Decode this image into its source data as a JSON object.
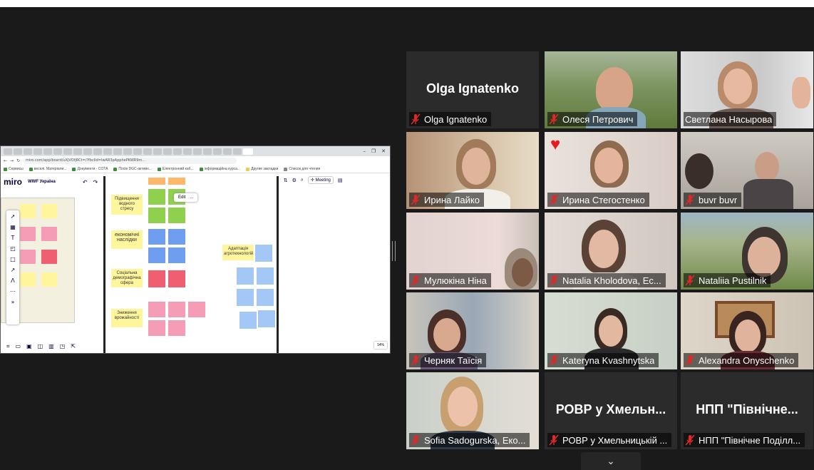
{
  "browser": {
    "url": "miro.com/app/board/uXjVOfjRCt=/?fbclid=IwAR3pApphePKWR9m...",
    "bookmarks": [
      "Сервисы",
      "веселі. Матеріали...",
      "Документи - COTA",
      "Посів DGC-активн...",
      "Електронний каб...",
      "інформаційна курса...",
      "Другие закладки",
      "Список для чтения"
    ],
    "window_controls": [
      "–",
      "❐",
      "✕"
    ]
  },
  "miro": {
    "logo": "miro",
    "board_name": "WWF Україна",
    "meeting_label": "Meeting",
    "zoom": "14%",
    "edit_popup": [
      "Edit",
      "..."
    ],
    "categories": [
      "Підвищення водного стресу",
      "економічні наслідки",
      "Соціальна демографічна сфера",
      "Зниження врожайності",
      "Адаптація агротехнологій"
    ],
    "colors": {
      "yellow": "#fff59d",
      "green": "#8fd14f",
      "blue": "#6f9ef0",
      "pink": "#f59db7",
      "red": "#ef5f71",
      "lightblue": "#a4c8f5",
      "orange": "#ffb86b"
    }
  },
  "participants": [
    {
      "name": "Olga Ignatenko",
      "big_label": "Olga Ignatenko",
      "video": false,
      "muted": true
    },
    {
      "name": "Олеся Петрович",
      "video": true,
      "muted": true
    },
    {
      "name": "Светлана Насырова",
      "video": true,
      "muted": false,
      "speaking": true
    },
    {
      "name": "Ирина Лайко",
      "video": true,
      "muted": true
    },
    {
      "name": "Ирина Стегостенко",
      "video": true,
      "muted": true,
      "reaction": "heart"
    },
    {
      "name": "buvr buvr",
      "video": true,
      "muted": true
    },
    {
      "name": "Мулюкіна Ніна",
      "video": true,
      "muted": true
    },
    {
      "name": "Natalia Kholodova,  Ec...",
      "video": true,
      "muted": true
    },
    {
      "name": "Nataliia Pustilnik",
      "video": true,
      "muted": true
    },
    {
      "name": "Черняк Таїсія",
      "video": true,
      "muted": true
    },
    {
      "name": "Kateryna Kvashnytska",
      "video": true,
      "muted": true
    },
    {
      "name": "Alexandra Onyschenko",
      "video": true,
      "muted": true
    },
    {
      "name": "Sofia Sadogurska, Еко...",
      "video": true,
      "muted": true
    },
    {
      "name": "РОВР у Хмельницькій ...",
      "big_label": "РОВР у Хмельн...",
      "video": false,
      "muted": true
    },
    {
      "name": "НПП \"Північне Поділл...",
      "big_label": "НПП \"Північне...",
      "video": false,
      "muted": true
    }
  ],
  "more_button_icon": "chevron-down-icon",
  "more_button_glyph": "⌄"
}
